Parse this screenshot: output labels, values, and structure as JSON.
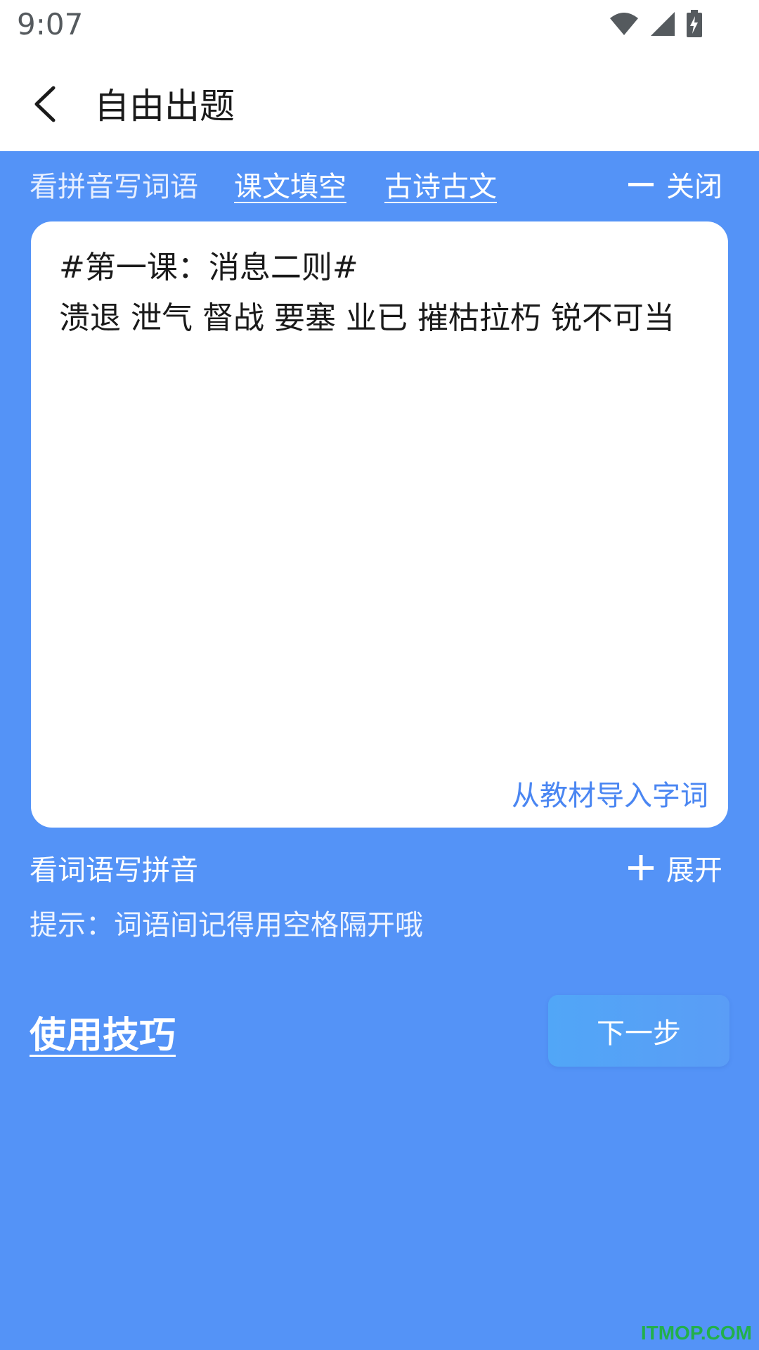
{
  "status_bar": {
    "time": "9:07",
    "icons": [
      "wifi-icon",
      "signal-icon",
      "battery-charging-icon"
    ]
  },
  "header": {
    "title": "自由出题",
    "back_icon": "back-arrow-icon"
  },
  "tabs": [
    {
      "label": "看拼音写词语",
      "underlined": false
    },
    {
      "label": "课文填空",
      "underlined": true
    },
    {
      "label": "古诗古文",
      "underlined": true
    }
  ],
  "close_toggle": {
    "icon": "minus-icon",
    "label": "关闭"
  },
  "editor": {
    "text": "#第一课：消息二则#\n溃退 泄气 督战 要塞 业已 摧枯拉朽 锐不可当",
    "import_label": "从教材导入字词"
  },
  "section2": {
    "title": "看词语写拼音",
    "expand_icon": "plus-icon",
    "expand_label": "展开"
  },
  "hint": "提示：词语间记得用空格隔开哦",
  "tips_label": "使用技巧",
  "next_label": "下一步",
  "watermark": "ITMOP.COM",
  "colors": {
    "background": "#5493f7",
    "card": "#ffffff",
    "link": "#4a86f2",
    "button": "#51a6f7"
  }
}
